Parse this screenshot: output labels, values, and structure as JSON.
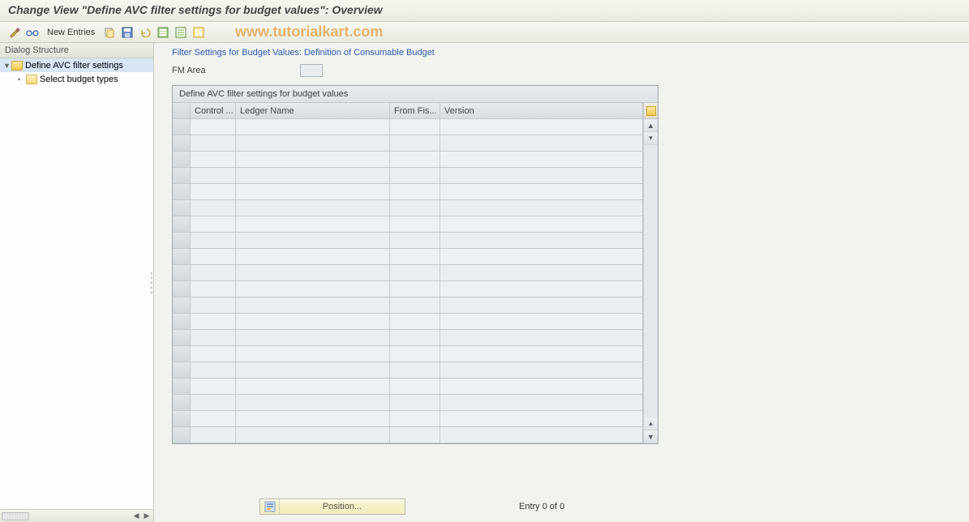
{
  "title": "Change View \"Define AVC filter settings for budget values\": Overview",
  "watermark": "www.tutorialkart.com",
  "toolbar": {
    "new_entries_label": "New Entries"
  },
  "sidebar": {
    "header": "Dialog Structure",
    "items": [
      {
        "label": "Define AVC filter settings",
        "expanded": true,
        "selected": true,
        "level": 0,
        "icon": "folder-open"
      },
      {
        "label": "Select budget types",
        "expanded": false,
        "selected": false,
        "level": 1,
        "icon": "folder-closed"
      }
    ]
  },
  "content": {
    "section_title": "Filter Settings for Budget Values: Definition of Consumable Budget",
    "fm_area_label": "FM Area",
    "fm_area_value": ""
  },
  "grid": {
    "title": "Define AVC filter settings for budget values",
    "columns": [
      "Control ...",
      "Ledger Name",
      "From Fis...",
      "Version"
    ],
    "rows": [
      [
        "",
        "",
        "",
        ""
      ],
      [
        "",
        "",
        "",
        ""
      ],
      [
        "",
        "",
        "",
        ""
      ],
      [
        "",
        "",
        "",
        ""
      ],
      [
        "",
        "",
        "",
        ""
      ],
      [
        "",
        "",
        "",
        ""
      ],
      [
        "",
        "",
        "",
        ""
      ],
      [
        "",
        "",
        "",
        ""
      ],
      [
        "",
        "",
        "",
        ""
      ],
      [
        "",
        "",
        "",
        ""
      ],
      [
        "",
        "",
        "",
        ""
      ],
      [
        "",
        "",
        "",
        ""
      ],
      [
        "",
        "",
        "",
        ""
      ],
      [
        "",
        "",
        "",
        ""
      ],
      [
        "",
        "",
        "",
        ""
      ],
      [
        "",
        "",
        "",
        ""
      ],
      [
        "",
        "",
        "",
        ""
      ],
      [
        "",
        "",
        "",
        ""
      ],
      [
        "",
        "",
        "",
        ""
      ],
      [
        "",
        "",
        "",
        ""
      ]
    ]
  },
  "footer": {
    "position_label": "Position...",
    "entry_text": "Entry 0 of 0"
  }
}
